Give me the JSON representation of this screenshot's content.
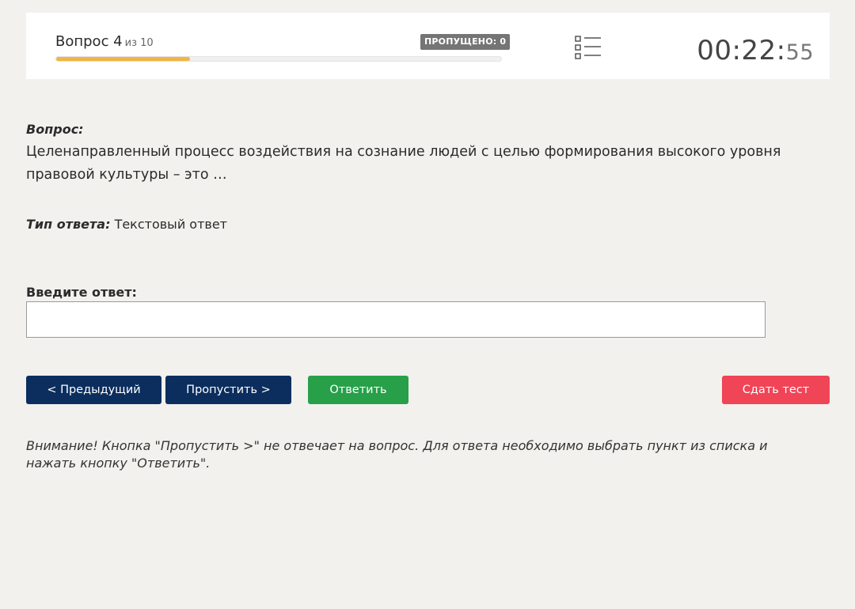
{
  "header": {
    "question_label": "Вопрос 4",
    "question_of": "из 10",
    "skipped_label": "ПРОПУЩЕНО: 0",
    "progress": 0.3,
    "progress_color": "#f0b545",
    "list_icon": "list-icon",
    "timer_main": "00:22:",
    "timer_seconds": "55"
  },
  "question": {
    "label": "Вопрос:",
    "text": "Целенаправленный процесс воздействия на сознание людей с целью формирования высокого уровня правовой культуры – это …"
  },
  "answer_type": {
    "label": "Тип ответа:",
    "value": "Текстовый ответ"
  },
  "answer_input": {
    "label": "Введите ответ:",
    "value": "",
    "placeholder": ""
  },
  "buttons": {
    "prev": "< Предыдущий",
    "skip": "Пропустить >",
    "answer": "Ответить",
    "submit": "Сдать тест"
  },
  "colors": {
    "nav_button": "#0b2e5e",
    "answer_button": "#27a049",
    "submit_button": "#f04457",
    "badge": "#757575"
  },
  "notice": "Внимание! Кнопка \"Пропустить >\" не отвечает на вопрос. Для ответа необходимо выбрать пункт из списка и нажать кнопку \"Ответить\"."
}
